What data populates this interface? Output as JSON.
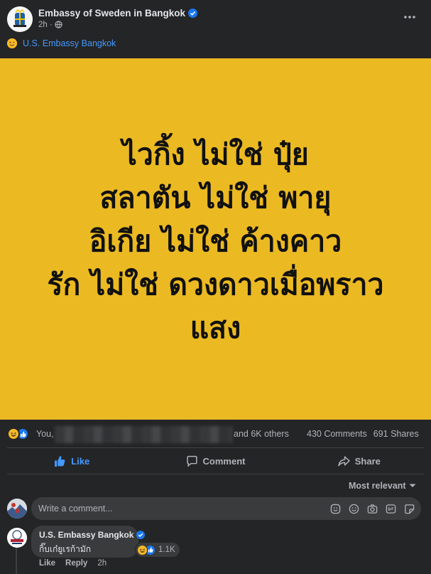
{
  "post": {
    "author": "Embassy of Sweden in Bangkok",
    "time": "2h",
    "tagged": "U.S. Embassy Bangkok",
    "image_text": [
      "ไวกิ้ง ไม่ใช่ ปุ๋ย",
      "สลาตัน ไม่ใช่ พายุ",
      "อิเกีย ไม่ใช่ ค้างคาว",
      "รัก ไม่ใช่ ดวงดาวเมื่อพราว",
      "แสง"
    ],
    "image_background": "#ebb922"
  },
  "reactions": {
    "you": "You,",
    "others": "and 6K others",
    "comments": "430 Comments",
    "shares": "691 Shares"
  },
  "actions": {
    "like": "Like",
    "comment": "Comment",
    "share": "Share"
  },
  "sort": {
    "label": "Most relevant"
  },
  "composer": {
    "placeholder": "Write a comment..."
  },
  "comment": {
    "author": "U.S. Embassy Bangkok",
    "text": "กิ๊บเก๋ยูเรก้ามัก",
    "reaction_count": "1.1K",
    "like": "Like",
    "reply": "Reply",
    "time": "2h"
  },
  "colors": {
    "accent": "#4599ff",
    "like_blue": "#1877f2",
    "haha_yellow": "#f7b928"
  },
  "icons": [
    "verified-badge-icon",
    "globe-icon",
    "more-dots-icon",
    "winking-emoji-icon",
    "like-thumb-icon",
    "comment-bubble-icon",
    "share-arrow-icon",
    "chevron-down-icon",
    "sticker-icon",
    "smile-icon",
    "camera-icon",
    "gif-icon",
    "avatar-sticker-icon"
  ]
}
